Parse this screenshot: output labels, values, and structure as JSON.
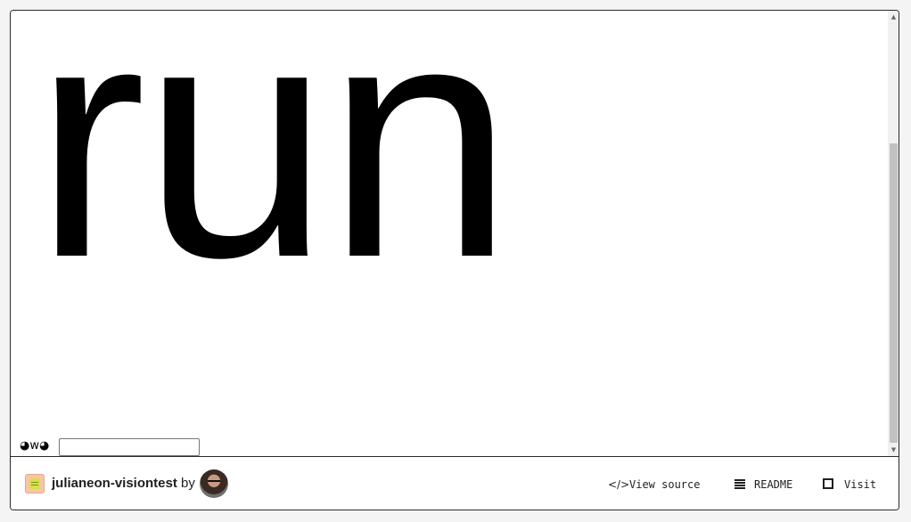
{
  "preview": {
    "big_text": "run",
    "emoticon": "◕w◕",
    "input_value": "",
    "input_placeholder": ""
  },
  "footer": {
    "project_name": "julianeon-visiontest",
    "by_label": "by",
    "actions": {
      "view_source": "View source",
      "readme": "README",
      "visit": "Visit"
    },
    "icons": {
      "project": "project-icon",
      "avatar": "user-avatar",
      "view_source": "code-icon",
      "readme": "list-icon",
      "visit": "fullscreen-icon"
    }
  },
  "colors": {
    "page_background": "#f4f4f4",
    "frame_border": "#2a2a2a",
    "text": "#000000",
    "scroll_thumb": "#c1c1c1"
  }
}
